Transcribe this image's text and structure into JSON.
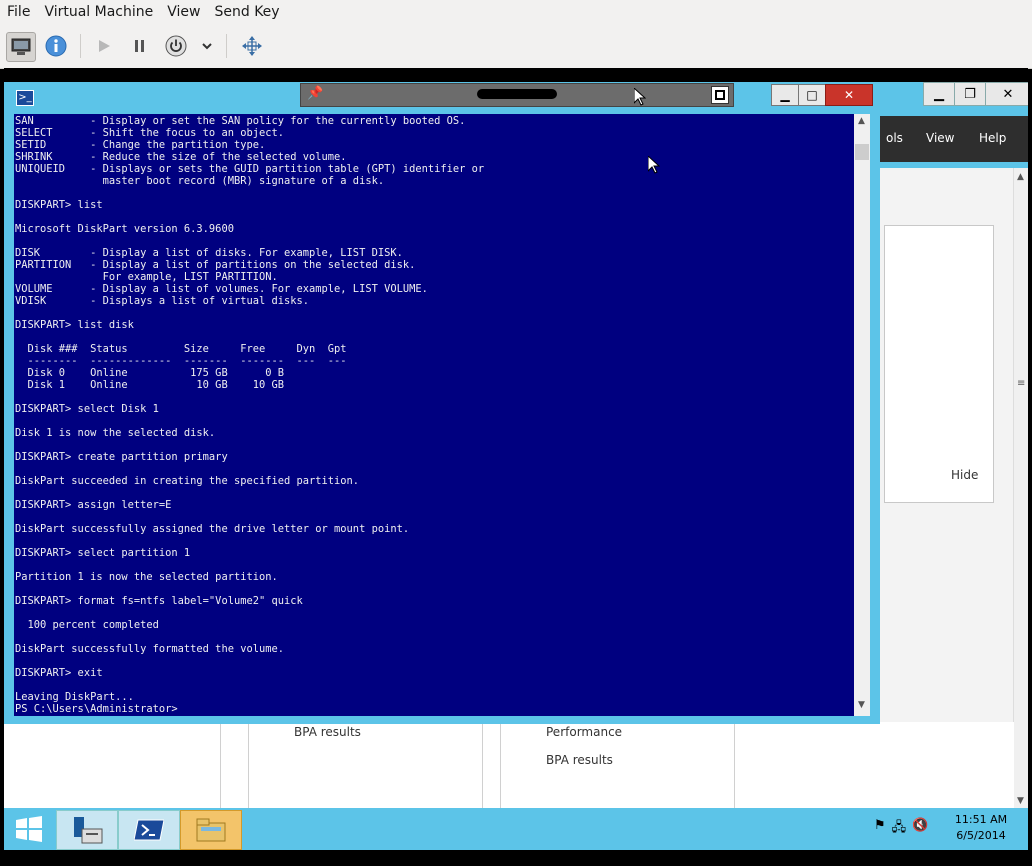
{
  "menubar": {
    "items": [
      "File",
      "Virtual Machine",
      "View",
      "Send Key"
    ]
  },
  "icons": {
    "console": "monitor-icon",
    "info": "info-icon",
    "play": "play-icon",
    "pause": "pause-icon",
    "power": "power-icon",
    "dropdown": "chevron-down-icon",
    "fit": "fit-window-icon"
  },
  "server_manager": {
    "menu": [
      "ols",
      "View",
      "Help"
    ],
    "hide_label": "Hide",
    "controls": [
      "▁",
      "❐",
      "✕"
    ]
  },
  "bottom_tiles": {
    "left_items": [
      "BPA results"
    ],
    "right_items": [
      "Performance",
      "BPA results"
    ]
  },
  "powershell": {
    "controls": [
      "▁",
      "□",
      "✕"
    ],
    "lines": [
      "SAN         - Display or set the SAN policy for the currently booted OS.",
      "SELECT      - Shift the focus to an object.",
      "SETID       - Change the partition type.",
      "SHRINK      - Reduce the size of the selected volume.",
      "UNIQUEID    - Displays or sets the GUID partition table (GPT) identifier or",
      "              master boot record (MBR) signature of a disk.",
      "",
      "DISKPART> list",
      "",
      "Microsoft DiskPart version 6.3.9600",
      "",
      "DISK        - Display a list of disks. For example, LIST DISK.",
      "PARTITION   - Display a list of partitions on the selected disk.",
      "              For example, LIST PARTITION.",
      "VOLUME      - Display a list of volumes. For example, LIST VOLUME.",
      "VDISK       - Displays a list of virtual disks.",
      "",
      "DISKPART> list disk",
      "",
      "  Disk ###  Status         Size     Free     Dyn  Gpt",
      "  --------  -------------  -------  -------  ---  ---",
      "  Disk 0    Online          175 GB      0 B",
      "  Disk 1    Online           10 GB    10 GB",
      "",
      "DISKPART> select Disk 1",
      "",
      "Disk 1 is now the selected disk.",
      "",
      "DISKPART> create partition primary",
      "",
      "DiskPart succeeded in creating the specified partition.",
      "",
      "DISKPART> assign letter=E",
      "",
      "DiskPart successfully assigned the drive letter or mount point.",
      "",
      "DISKPART> select partition 1",
      "",
      "Partition 1 is now the selected partition.",
      "",
      "DISKPART> format fs=ntfs label=\"Volume2\" quick",
      "",
      "  100 percent completed",
      "",
      "DiskPart successfully formatted the volume.",
      "",
      "DISKPART> exit",
      "",
      "Leaving DiskPart...",
      "PS C:\\Users\\Administrator>"
    ]
  },
  "taskbar": {
    "time": "11:51 AM",
    "date": "6/5/2014"
  },
  "colors": {
    "console_bg": "#000080",
    "window_frame": "#5cc4e8",
    "close_red": "#c9342a",
    "taskbar_active": "#f3c46a"
  }
}
